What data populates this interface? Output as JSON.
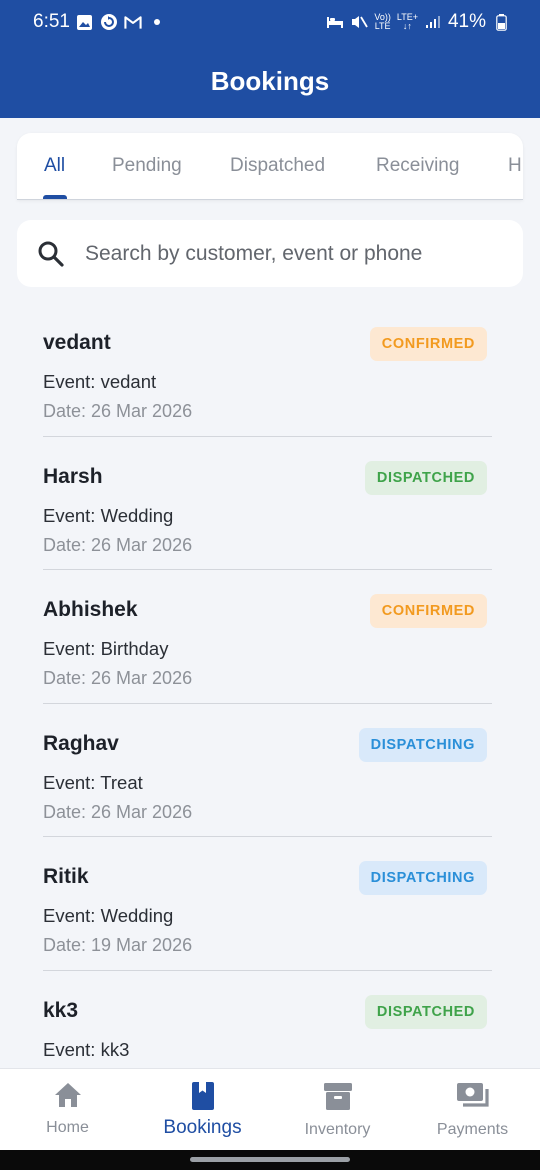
{
  "status": {
    "time": "6:51",
    "battery": "41%",
    "volte_top": "Vo))",
    "volte_bottom": "LTE",
    "lte": "LTE+"
  },
  "header": {
    "title": "Bookings"
  },
  "tabs": [
    {
      "label": "All",
      "active": true
    },
    {
      "label": "Pending",
      "active": false
    },
    {
      "label": "Dispatched",
      "active": false
    },
    {
      "label": "Receiving",
      "active": false
    },
    {
      "label": "H",
      "active": false
    }
  ],
  "search": {
    "placeholder": "Search by customer, event or phone",
    "value": ""
  },
  "bookings": [
    {
      "name": "vedant",
      "event": "Event: vedant",
      "date": "Date: 26 Mar 2026",
      "status": "CONFIRMED"
    },
    {
      "name": "Harsh",
      "event": "Event: Wedding",
      "date": "Date: 26 Mar 2026",
      "status": "DISPATCHED"
    },
    {
      "name": "Abhishek",
      "event": "Event: Birthday",
      "date": "Date: 26 Mar 2026",
      "status": "CONFIRMED"
    },
    {
      "name": "Raghav",
      "event": "Event: Treat",
      "date": "Date: 26 Mar 2026",
      "status": "DISPATCHING"
    },
    {
      "name": "Ritik",
      "event": "Event: Wedding",
      "date": "Date: 19 Mar 2026",
      "status": "DISPATCHING"
    },
    {
      "name": "kk3",
      "event": "Event: kk3",
      "date": "",
      "status": "DISPATCHED"
    }
  ],
  "status_styles": {
    "CONFIRMED": {
      "bg": "#fde8d2",
      "fg": "#f29a1f"
    },
    "DISPATCHED": {
      "bg": "#e1efe2",
      "fg": "#3fa34a"
    },
    "DISPATCHING": {
      "bg": "#d9e9fa",
      "fg": "#2a8fd8"
    }
  },
  "nav": [
    {
      "label": "Home",
      "icon": "home-icon",
      "active": false
    },
    {
      "label": "Bookings",
      "icon": "bookings-icon",
      "active": true
    },
    {
      "label": "Inventory",
      "icon": "inventory-icon",
      "active": false
    },
    {
      "label": "Payments",
      "icon": "payments-icon",
      "active": false
    }
  ],
  "colors": {
    "primary": "#1f4ea3",
    "background": "#f3f5f9",
    "inactive": "#8a8f98"
  }
}
